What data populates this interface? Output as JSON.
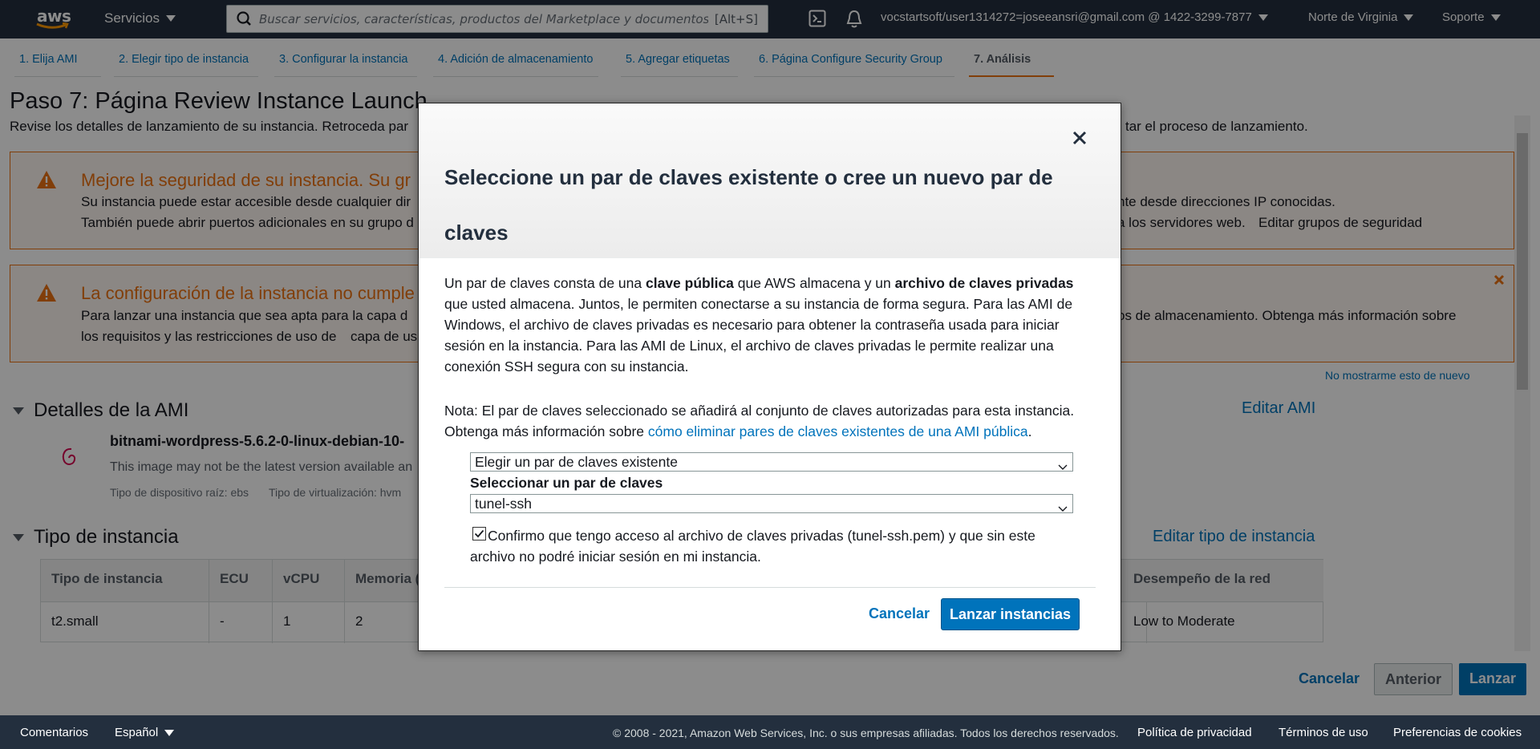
{
  "topnav": {
    "logo": "aws",
    "services": "Servicios",
    "search_placeholder": "Buscar servicios, características, productos del Marketplace y documentos",
    "search_shortcut": "[Alt+S]",
    "account": "vocstartsoft/user1314272=joseeansri@gmail.com @ 1422-3299-7877",
    "region": "Norte de Virginia",
    "support": "Soporte"
  },
  "steps": [
    {
      "label": "1. Elija AMI"
    },
    {
      "label": "2. Elegir tipo de instancia"
    },
    {
      "label": "3. Configurar la instancia"
    },
    {
      "label": "4. Adición de almacenamiento"
    },
    {
      "label": "5. Agregar etiquetas"
    },
    {
      "label": "6. Página Configure Security Group"
    },
    {
      "label": "7. Análisis"
    }
  ],
  "page": {
    "title": "Paso 7: Página Review Instance Launch",
    "subtitle_start": "Revise los detalles de lanzamiento de su instancia. Retroceda par",
    "subtitle_end": "tar el proceso de lanzamiento.",
    "alert1": {
      "title": "Mejore la seguridad de su instancia. Su gr",
      "line1_start": "Su instancia puede estar accesible desde cualquier dir",
      "line1_end": "nte desde direcciones IP conocidas.",
      "line2_start": "También puede abrir puertos adicionales en su grupo d",
      "line2_end": "a los servidores web.",
      "line2_link": "Editar grupos de seguridad"
    },
    "alert2": {
      "title": "La configuración de la instancia no cumple",
      "line1_start": "Para lanzar una instancia que sea apta para la capa d",
      "line1_end": "os de almacenamiento. Obtenga más información sobre",
      "line2_start": "los requisitos y las restricciones de uso de",
      "line2_link": "capa de us",
      "dismiss": "No mostrarme esto de nuevo"
    },
    "ami_section": {
      "title": "Detalles de la AMI",
      "edit": "Editar AMI",
      "name": "bitnami-wordpress-5.6.2-0-linux-debian-10-",
      "desc": "This image may not be the latest version available an",
      "root_device": "Tipo de dispositivo raíz: ebs",
      "virt_type": "Tipo de virtualización: hvm"
    },
    "instance_section": {
      "title": "Tipo de instancia",
      "edit": "Editar tipo de instancia",
      "headers": [
        "Tipo de instancia",
        "ECU",
        "vCPU",
        "Memoria (",
        "Desempeño de la red"
      ],
      "row": [
        "t2.small",
        "-",
        "1",
        "2",
        "Low to Moderate"
      ]
    },
    "buttons": {
      "cancel": "Cancelar",
      "previous": "Anterior",
      "launch": "Lanzar"
    }
  },
  "modal": {
    "title": "Seleccione un par de claves existente o cree un nuevo par de claves",
    "p1_a": "Un par de claves consta de una ",
    "p1_b": "clave pública",
    "p1_c": " que AWS almacena y un ",
    "p1_d": "archivo de claves privadas",
    "p1_e": " que usted almacena. Juntos, le permiten conectarse a su instancia de forma segura. Para las AMI de Windows, el archivo de claves privadas es necesario para obtener la contraseña usada para iniciar sesión en la instancia. Para las AMI de Linux, el archivo de claves privadas le permite realizar una conexión SSH segura con su instancia.",
    "note_a": "Nota: El par de claves seleccionado se añadirá al conjunto de claves autorizadas para esta instancia. Obtenga más información sobre ",
    "note_link": "cómo eliminar pares de claves existentes de una AMI pública",
    "note_end": ".",
    "mode_select": "Elegir un par de claves existente",
    "keypair_label": "Seleccionar un par de claves",
    "keypair_select": "tunel-ssh",
    "ack_checked": true,
    "ack_text": "Confirmo que tengo acceso al archivo de claves privadas (tunel-ssh.pem) y que sin este archivo no podré iniciar sesión en mi instancia.",
    "cancel": "Cancelar",
    "launch": "Lanzar instancias"
  },
  "footer": {
    "feedback": "Comentarios",
    "language": "Español",
    "copyright": "© 2008 - 2021, Amazon Web Services, Inc. o sus empresas afiliadas. Todos los derechos reservados.",
    "privacy": "Política de privacidad",
    "terms": "Términos de uso",
    "cookies": "Preferencias de cookies"
  },
  "colors": {
    "nav_bg": "#232f3e",
    "link": "#0073bb",
    "warning": "#ec7211",
    "primary_button": "#0073bb"
  }
}
